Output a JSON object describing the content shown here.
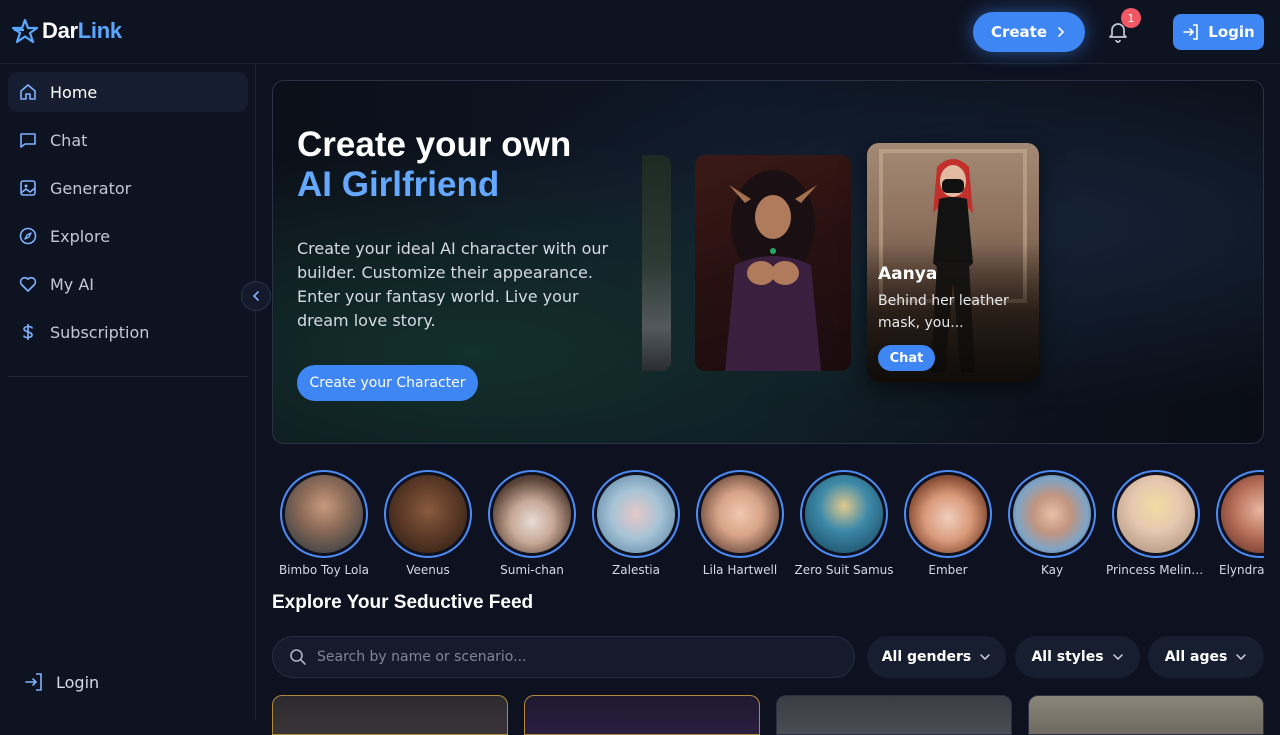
{
  "brand": {
    "name_part1": "Dar",
    "name_part2": "Link"
  },
  "header": {
    "create_label": "Create",
    "notification_count": "1",
    "login_label": "Login"
  },
  "sidebar": {
    "items": [
      {
        "label": "Home",
        "icon": "home-icon",
        "active": true
      },
      {
        "label": "Chat",
        "icon": "chat-icon"
      },
      {
        "label": "Generator",
        "icon": "image-icon"
      },
      {
        "label": "Explore",
        "icon": "compass-icon"
      },
      {
        "label": "My AI",
        "icon": "heart-icon"
      },
      {
        "label": "Subscription",
        "icon": "dollar-icon"
      }
    ],
    "login_label": "Login"
  },
  "hero": {
    "title_line1": "Create your own",
    "title_line2": "AI Girlfriend",
    "description": "Create your ideal AI character with our builder. Customize their appearance. Enter your fantasy world. Live your dream love story.",
    "cta_label": "Create your Character",
    "featured": {
      "name": "Aanya",
      "description": "Behind her leather mask, you...",
      "chat_label": "Chat"
    }
  },
  "characters": [
    {
      "name": "Bimbo Toy Lola"
    },
    {
      "name": "Veenus"
    },
    {
      "name": "Sumi-chan"
    },
    {
      "name": "Zalestia"
    },
    {
      "name": "Lila Hartwell"
    },
    {
      "name": "Zero Suit Samus"
    },
    {
      "name": "Ember"
    },
    {
      "name": "Kay"
    },
    {
      "name": "Princess Melinda"
    },
    {
      "name": "Elyndra Moon"
    }
  ],
  "feed": {
    "title": "Explore Your Seductive Feed",
    "search_placeholder": "Search by name or scenario...",
    "filters": [
      {
        "label": "All genders"
      },
      {
        "label": "All styles"
      },
      {
        "label": "All ages"
      }
    ]
  },
  "colors": {
    "accent": "#3e86f3",
    "accent_light": "#64a8ff",
    "background": "#0d1120",
    "badge": "#ef5864"
  }
}
